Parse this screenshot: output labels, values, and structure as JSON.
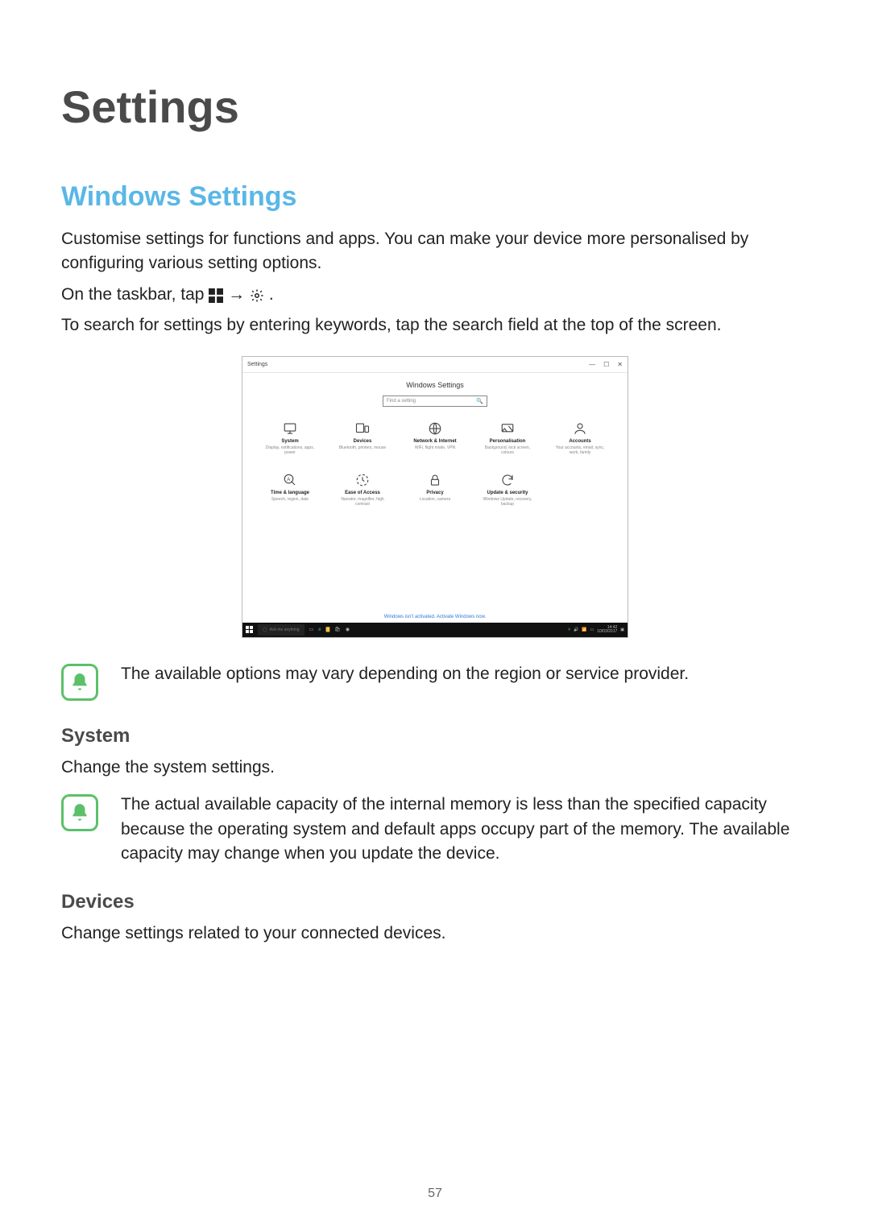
{
  "page_number": "57",
  "title": "Settings",
  "section": {
    "heading": "Windows Settings",
    "p1": "Customise settings for functions and apps. You can make your device more personalised by configuring various setting options.",
    "p2_pre": "On the taskbar, tap ",
    "p2_arrow": " → ",
    "p2_post": ".",
    "p3": "To search for settings by entering keywords, tap the search field at the top of the screen."
  },
  "screenshot": {
    "window_title": "Settings",
    "body_title": "Windows Settings",
    "search_placeholder": "Find a setting",
    "tiles": [
      {
        "label": "System",
        "sub": "Display, notifications, apps, power"
      },
      {
        "label": "Devices",
        "sub": "Bluetooth, printers, mouse"
      },
      {
        "label": "Network & Internet",
        "sub": "WiFi, flight mode, VPN"
      },
      {
        "label": "Personalisation",
        "sub": "Background, lock screen, colours"
      },
      {
        "label": "Accounts",
        "sub": "Your accounts, email, sync, work, family"
      },
      {
        "label": "Time & language",
        "sub": "Speech, region, date"
      },
      {
        "label": "Ease of Access",
        "sub": "Narrator, magnifier, high contrast"
      },
      {
        "label": "Privacy",
        "sub": "Location, camera"
      },
      {
        "label": "Update & security",
        "sub": "Windows Update, recovery, backup"
      }
    ],
    "activation": "Windows isn't activated. Activate Windows now.",
    "taskbar": {
      "cortana": "Ask me anything",
      "clock_time": "14:42",
      "clock_date": "10/03/2017"
    }
  },
  "note1": "The available options may vary depending on the region or service provider.",
  "system": {
    "heading": "System",
    "desc": "Change the system settings.",
    "note": "The actual available capacity of the internal memory is less than the specified capacity because the operating system and default apps occupy part of the memory. The available capacity may change when you update the device."
  },
  "devices": {
    "heading": "Devices",
    "desc": "Change settings related to your connected devices."
  }
}
